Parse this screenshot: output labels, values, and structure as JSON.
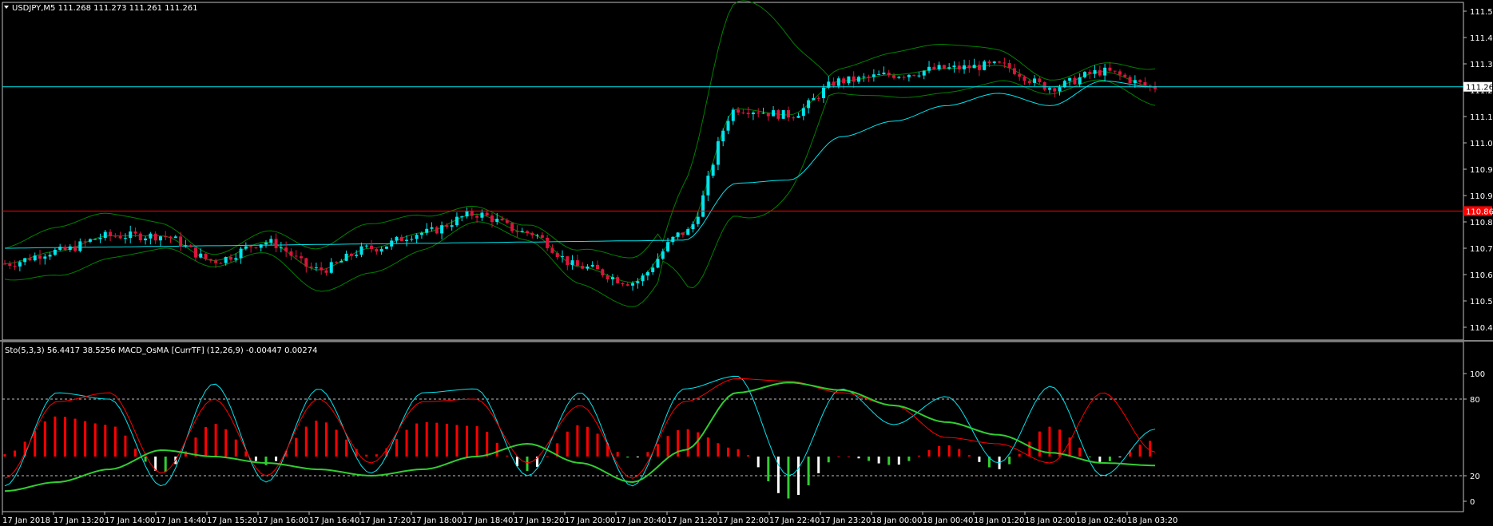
{
  "colors": {
    "background": "#000000",
    "frame": "#c0c0c0",
    "bull_candle": "#00e5ee",
    "bear_candle": "#dc143c",
    "bollinger": "#008000",
    "ma": "#00e5ee",
    "price_line": "#00e5ee",
    "level_line": "#ff0000",
    "sto_main": "#00e5ee",
    "sto_signal": "#ff0000",
    "macd_signal": "#32cd32",
    "osma_up": "#ff0000",
    "osma_down": "#ffffff",
    "osma_green": "#32cd32"
  },
  "main_panel": {
    "header": "USDJPY,M5  111.268 111.273 111.261 111.261",
    "price_tag": "111.261",
    "level_tag": "110.860",
    "y_ticks": [
      "111.505",
      "111.420",
      "111.335",
      "111.250",
      "111.165",
      "111.080",
      "110.995",
      "110.910",
      "110.825",
      "110.740",
      "110.655",
      "110.570",
      "110.485"
    ]
  },
  "sub_panel": {
    "header": "Sto(5,3,3) 56.4417 38.5256  MACD_OsMA [CurrTF] (12,26,9) -0.00447 0.00274",
    "y_ticks": [
      "100",
      "80",
      "20",
      "0"
    ]
  },
  "x_ticks": [
    "17 Jan 2018",
    "17 Jan 13:20",
    "17 Jan 14:00",
    "17 Jan 14:40",
    "17 Jan 15:20",
    "17 Jan 16:00",
    "17 Jan 16:40",
    "17 Jan 17:20",
    "17 Jan 18:00",
    "17 Jan 18:40",
    "17 Jan 19:20",
    "17 Jan 20:00",
    "17 Jan 20:40",
    "17 Jan 21:20",
    "17 Jan 22:00",
    "17 Jan 22:40",
    "17 Jan 23:20",
    "18 Jan 00:00",
    "18 Jan 00:40",
    "18 Jan 01:20",
    "18 Jan 02:00",
    "18 Jan 02:40",
    "18 Jan 03:20"
  ],
  "chart_data": [
    {
      "type": "line",
      "title": "USDJPY,M5",
      "x": [
        "17 Jan 2018",
        "17 Jan 13:20",
        "17 Jan 14:00",
        "17 Jan 14:40",
        "17 Jan 15:20",
        "17 Jan 16:00",
        "17 Jan 16:40",
        "17 Jan 17:20",
        "17 Jan 18:00",
        "17 Jan 18:40",
        "17 Jan 19:20",
        "17 Jan 20:00",
        "17 Jan 20:40",
        "17 Jan 21:20",
        "17 Jan 22:00",
        "17 Jan 22:40",
        "17 Jan 23:20",
        "18 Jan 00:00",
        "18 Jan 00:40",
        "18 Jan 01:20",
        "18 Jan 02:00",
        "18 Jan 02:40",
        "18 Jan 03:20"
      ],
      "series": [
        {
          "name": "",
          "values": [
            110.69,
            110.73,
            110.78,
            110.78,
            110.7,
            110.76,
            110.67,
            110.74,
            110.79,
            110.85,
            110.79,
            110.68,
            110.63,
            110.79,
            111.19,
            111.17,
            111.28,
            111.3,
            111.32,
            111.33,
            111.26,
            111.31,
            111.26
          ]
        }
      ],
      "ylim": [
        110.485,
        111.505
      ],
      "horizontal_lines": [
        111.261,
        110.86
      ],
      "candle_range": [
        110.62,
        111.39
      ],
      "last_ohlc": [
        111.268,
        111.273,
        111.261,
        111.261
      ]
    },
    {
      "type": "line",
      "title": "Sto(5,3,3) 56.4417 38.5256  MACD_OsMA [CurrTF] (12,26,9) -0.00447 0.00274",
      "x": [
        "17 Jan 2018",
        "17 Jan 13:20",
        "17 Jan 14:00",
        "17 Jan 14:40",
        "17 Jan 15:20",
        "17 Jan 16:00",
        "17 Jan 16:40",
        "17 Jan 17:20",
        "17 Jan 18:00",
        "17 Jan 18:40",
        "17 Jan 19:20",
        "17 Jan 20:00",
        "17 Jan 20:40",
        "17 Jan 21:20",
        "17 Jan 22:00",
        "17 Jan 22:40",
        "17 Jan 23:20",
        "18 Jan 00:00",
        "18 Jan 00:40",
        "18 Jan 01:20",
        "18 Jan 02:00",
        "18 Jan 02:40",
        "18 Jan 03:20"
      ],
      "series": [
        {
          "name": "",
          "values": [
            12,
            85,
            80,
            12,
            92,
            15,
            88,
            22,
            85,
            88,
            20,
            85,
            12,
            88,
            98,
            20,
            88,
            60,
            82,
            30,
            90,
            20,
            56.4417
          ]
        },
        {
          "name": "",
          "values": [
            18,
            78,
            85,
            22,
            80,
            20,
            80,
            30,
            78,
            80,
            30,
            75,
            18,
            78,
            96,
            94,
            85,
            75,
            50,
            45,
            30,
            85,
            38.5256
          ]
        },
        {
          "name": "",
          "values": [
            8,
            15,
            25,
            40,
            35,
            30,
            25,
            20,
            25,
            35,
            45,
            30,
            15,
            40,
            85,
            93,
            87,
            75,
            62,
            52,
            38,
            30,
            28
          ]
        }
      ],
      "ylim": [
        0,
        100
      ],
      "levels": [
        80,
        20
      ]
    }
  ]
}
